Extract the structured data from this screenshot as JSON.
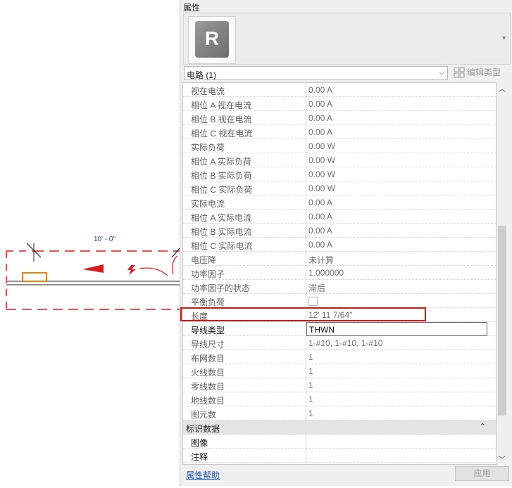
{
  "drawing": {
    "dimension_text": "10' - 0\"",
    "colors": {
      "annotation_red": "#d81e1e",
      "dimension_blue": "#1f3f8f",
      "device_orange": "#e08a00"
    }
  },
  "panel": {
    "title": "属性",
    "type_logo": "R",
    "selector": "电路 (1)",
    "edit_type": "编辑类型",
    "rows": [
      {
        "name": "视在电流",
        "value": "0.00 A"
      },
      {
        "name": "相位 A 视在电流",
        "value": "0.00 A"
      },
      {
        "name": "相位 B 视在电流",
        "value": "0.00 A"
      },
      {
        "name": "相位 C 视在电流",
        "value": "0.00 A"
      },
      {
        "name": "实际负荷",
        "value": "0.00 W"
      },
      {
        "name": "相位 A 实际负荷",
        "value": "0.00 W"
      },
      {
        "name": "相位 B 实际负荷",
        "value": "0.00 W"
      },
      {
        "name": "相位 C 实际负荷",
        "value": "0.00 W"
      },
      {
        "name": "实际电流",
        "value": "0.00 A"
      },
      {
        "name": "相位 A 实际电流",
        "value": "0.00 A"
      },
      {
        "name": "相位 B 实际电流",
        "value": "0.00 A"
      },
      {
        "name": "相位 C 实际电流",
        "value": "0.00 A"
      },
      {
        "name": "电压降",
        "value": "未计算"
      },
      {
        "name": "功率因子",
        "value": "1.000000"
      },
      {
        "name": "功率因子的状态",
        "value": "滞后"
      },
      {
        "name": "平衡负荷",
        "value": ""
      },
      {
        "name": "长度",
        "value": "12'  11 7/64\""
      },
      {
        "name": "导线类型",
        "value": "THWN"
      },
      {
        "name": "导线尺寸",
        "value": "1-#10, 1-#10, 1-#10"
      },
      {
        "name": "布网数目",
        "value": "1"
      },
      {
        "name": "火线数目",
        "value": "1"
      },
      {
        "name": "零线数目",
        "value": "1"
      },
      {
        "name": "地线数目",
        "value": "1"
      },
      {
        "name": "图元数",
        "value": "1"
      }
    ],
    "section": "标识数据",
    "section_rows": [
      {
        "name": "图像",
        "value": ""
      },
      {
        "name": "注释",
        "value": ""
      }
    ],
    "help_link": "属性帮助",
    "apply": "应用",
    "highlight_color": "#e01010"
  }
}
